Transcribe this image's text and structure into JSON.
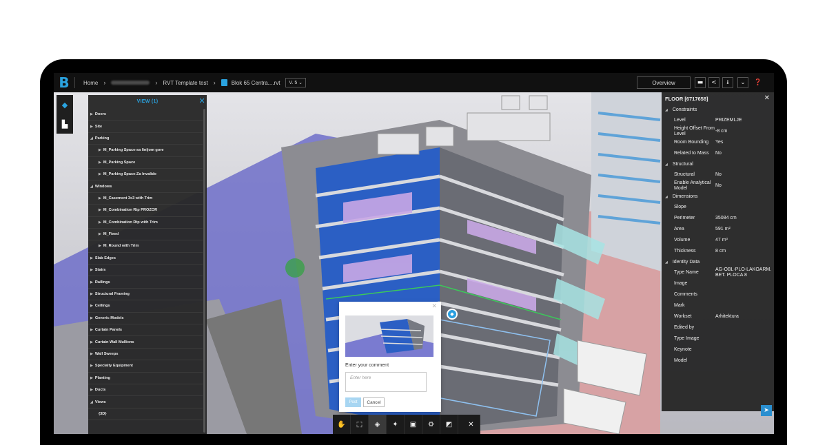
{
  "app": {
    "logo": "B",
    "accent": "#2aa3e0"
  },
  "breadcrumb": {
    "home": "Home",
    "project": "RVT Template test",
    "file": "Blok 65 Centra....rvt",
    "version": "V. 5 ⌄"
  },
  "header": {
    "overview": "Overview",
    "icons": [
      "comment-icon",
      "share-icon",
      "download-icon",
      "chevron-down-icon",
      "help-icon"
    ]
  },
  "view_panel": {
    "title": "VIEW (1)",
    "items": [
      {
        "label": "Doors",
        "level": 0,
        "open": false
      },
      {
        "label": "Site",
        "level": 0,
        "open": false
      },
      {
        "label": "Parking",
        "level": 0,
        "open": true
      },
      {
        "label": "M_Parking Space-sa linijom gore",
        "level": 1,
        "open": false
      },
      {
        "label": "M_Parking Space",
        "level": 1,
        "open": false
      },
      {
        "label": "M_Parking Space-Za Invalide",
        "level": 1,
        "open": false
      },
      {
        "label": "Windows",
        "level": 0,
        "open": true
      },
      {
        "label": "M_Casement 3x3 with Trim",
        "level": 1,
        "open": false
      },
      {
        "label": "M_Combination Rtp PROZOR",
        "level": 1,
        "open": false
      },
      {
        "label": "M_Combination Rtp with Trim",
        "level": 1,
        "open": false
      },
      {
        "label": "M_Fixed",
        "level": 1,
        "open": false
      },
      {
        "label": "M_Round with Trim",
        "level": 1,
        "open": false
      },
      {
        "label": "Slab Edges",
        "level": 0,
        "open": false
      },
      {
        "label": "Stairs",
        "level": 0,
        "open": false
      },
      {
        "label": "Railings",
        "level": 0,
        "open": false
      },
      {
        "label": "Structural Framing",
        "level": 0,
        "open": false
      },
      {
        "label": "Ceilings",
        "level": 0,
        "open": false
      },
      {
        "label": "Generic Models",
        "level": 0,
        "open": false
      },
      {
        "label": "Curtain Panels",
        "level": 0,
        "open": false
      },
      {
        "label": "Curtain Wall Mullions",
        "level": 0,
        "open": false
      },
      {
        "label": "Wall Sweeps",
        "level": 0,
        "open": false
      },
      {
        "label": "Specialty Equipment",
        "level": 0,
        "open": false
      },
      {
        "label": "Planting",
        "level": 0,
        "open": false
      },
      {
        "label": "Ducts",
        "level": 0,
        "open": false
      },
      {
        "label": "Views",
        "level": 0,
        "open": true
      },
      {
        "label": "{3D}",
        "level": 1,
        "open": null
      }
    ]
  },
  "properties": {
    "title": "FLOOR [6717658]",
    "sections": [
      {
        "name": "Constraints",
        "rows": [
          {
            "label": "Level",
            "value": "PRIZEMLJE"
          },
          {
            "label": "Height Offset From Level",
            "value": "-8 cm"
          },
          {
            "label": "Room Bounding",
            "value": "Yes"
          },
          {
            "label": "Related to Mass",
            "value": "No"
          }
        ]
      },
      {
        "name": "Structural",
        "rows": [
          {
            "label": "Structural",
            "value": "No"
          },
          {
            "label": "Enable Analytical Model",
            "value": "No"
          }
        ]
      },
      {
        "name": "Dimensions",
        "rows": [
          {
            "label": "Slope",
            "value": ""
          },
          {
            "label": "Perimeter",
            "value": "35084 cm"
          },
          {
            "label": "Area",
            "value": "591 m²"
          },
          {
            "label": "Volume",
            "value": "47 m³"
          },
          {
            "label": "Thickness",
            "value": "8 cm"
          }
        ]
      },
      {
        "name": "Identity Data",
        "rows": [
          {
            "label": "Type Name",
            "value": "AG-OBL-PLO-LAKOARM. BET. PLOCA 8"
          },
          {
            "label": "Image",
            "value": ""
          },
          {
            "label": "Comments",
            "value": ""
          },
          {
            "label": "Mark",
            "value": ""
          },
          {
            "label": "Workset",
            "value": "Arhitektura"
          },
          {
            "label": "Edited by",
            "value": ""
          },
          {
            "label": "Type Image",
            "value": ""
          },
          {
            "label": "Keynote",
            "value": ""
          },
          {
            "label": "Model",
            "value": ""
          }
        ]
      }
    ]
  },
  "comment": {
    "label": "Enter your comment",
    "placeholder": "Enter here",
    "post": "Post",
    "cancel": "Cancel"
  },
  "toolbar": {
    "tools": [
      "pan-icon",
      "zoom-window-icon",
      "view-cube-icon",
      "explode-icon",
      "save-view-icon",
      "settings-icon",
      "fullscreen-icon",
      "close-icon"
    ]
  }
}
